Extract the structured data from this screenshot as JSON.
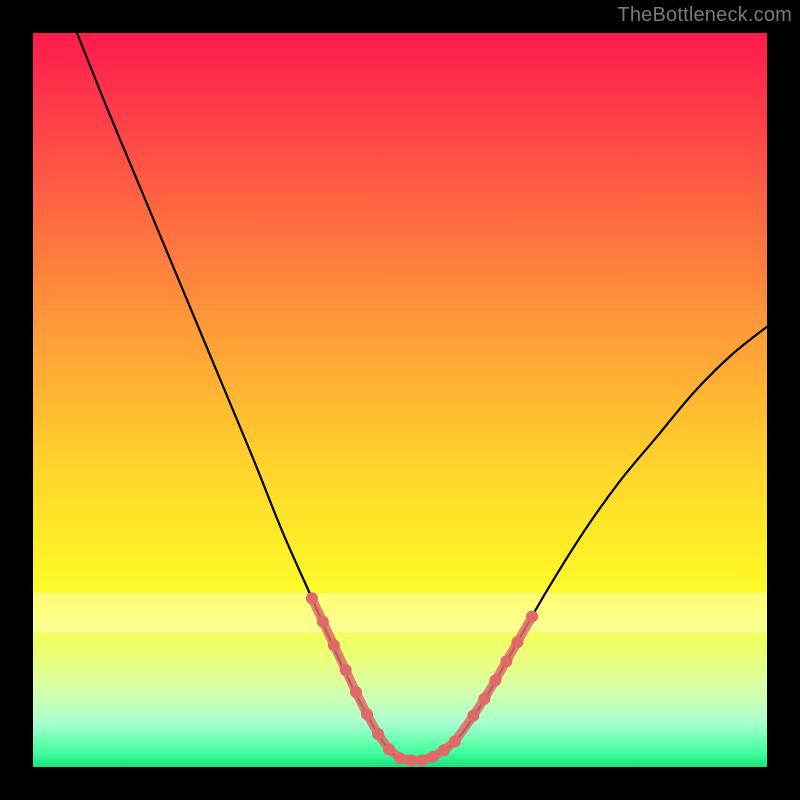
{
  "attribution": "TheBottleneck.com",
  "colors": {
    "frame": "#000000",
    "gradient_top": "#ff1a4d",
    "gradient_bottom": "#14e47a",
    "curve": "#000000",
    "beads": "#e06a6a"
  },
  "chart_data": {
    "type": "line",
    "title": "",
    "xlabel": "",
    "ylabel": "",
    "xlim": [
      0,
      100
    ],
    "ylim": [
      0,
      100
    ],
    "notes": "V-shaped bottleneck curve on a red→green vertical gradient; pink bead segments highlight the near-bottom region of the curve. No axes, ticks, or legend are shown.",
    "series": [
      {
        "name": "curve",
        "x": [
          6,
          10,
          15,
          20,
          25,
          30,
          34,
          38,
          42,
          45,
          47,
          49,
          51,
          53,
          55,
          58,
          62,
          66,
          70,
          75,
          80,
          85,
          90,
          95,
          100
        ],
        "values": [
          100,
          90,
          78,
          66,
          54,
          42,
          32,
          23,
          14,
          8,
          4.5,
          1.8,
          0.9,
          0.9,
          1.6,
          4,
          10,
          17,
          24,
          32,
          39,
          45,
          51,
          56,
          60
        ]
      }
    ],
    "beads": [
      {
        "x": 38,
        "y": 23
      },
      {
        "x": 39.5,
        "y": 19.8
      },
      {
        "x": 41,
        "y": 16.6
      },
      {
        "x": 42.6,
        "y": 13.2
      },
      {
        "x": 44,
        "y": 10.2
      },
      {
        "x": 45.5,
        "y": 7.2
      },
      {
        "x": 47,
        "y": 4.5
      },
      {
        "x": 48.5,
        "y": 2.4
      },
      {
        "x": 50,
        "y": 1.2
      },
      {
        "x": 51.5,
        "y": 0.9
      },
      {
        "x": 53,
        "y": 0.9
      },
      {
        "x": 54.5,
        "y": 1.4
      },
      {
        "x": 56,
        "y": 2.3
      },
      {
        "x": 57.5,
        "y": 3.5
      },
      {
        "x": 60,
        "y": 7
      },
      {
        "x": 61.5,
        "y": 9.3
      },
      {
        "x": 63,
        "y": 11.8
      },
      {
        "x": 64.5,
        "y": 14.4
      },
      {
        "x": 66,
        "y": 17
      },
      {
        "x": 68,
        "y": 20.5
      }
    ]
  }
}
